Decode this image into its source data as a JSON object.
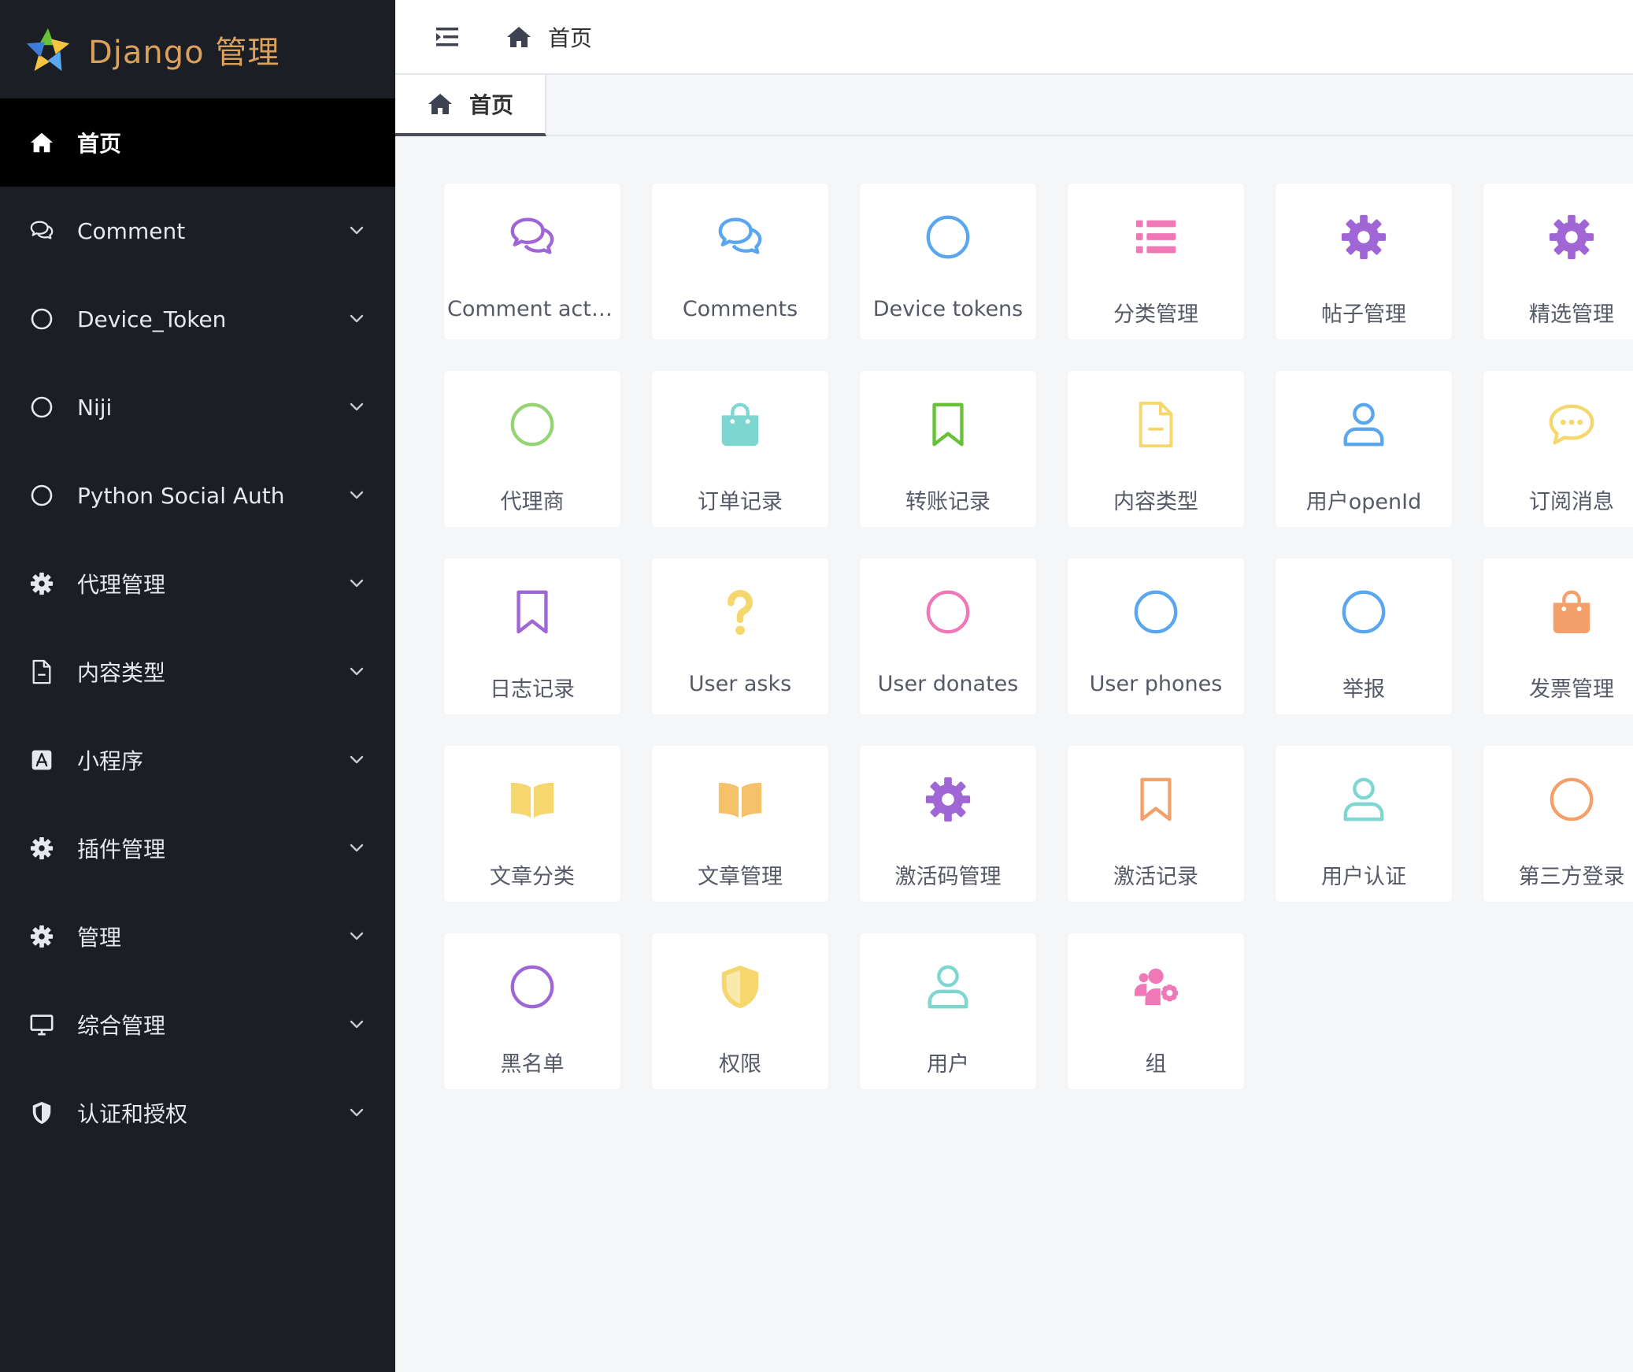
{
  "brand": {
    "title": "Django 管理"
  },
  "header": {
    "breadcrumb": "首页"
  },
  "tabs": [
    {
      "label": "首页"
    }
  ],
  "sidebar": {
    "items": [
      {
        "label": "首页",
        "icon": "home-icon",
        "active": true
      },
      {
        "label": "Comment",
        "icon": "comments-icon"
      },
      {
        "label": "Device_Token",
        "icon": "circle-icon"
      },
      {
        "label": "Niji",
        "icon": "circle-icon"
      },
      {
        "label": "Python Social Auth",
        "icon": "circle-icon"
      },
      {
        "label": "代理管理",
        "icon": "gear-icon"
      },
      {
        "label": "内容类型",
        "icon": "file-icon"
      },
      {
        "label": "小程序",
        "icon": "app-store-icon"
      },
      {
        "label": "插件管理",
        "icon": "gear-icon"
      },
      {
        "label": "管理",
        "icon": "gear-icon"
      },
      {
        "label": "综合管理",
        "icon": "monitor-icon"
      },
      {
        "label": "认证和授权",
        "icon": "shield-icon"
      }
    ]
  },
  "cards": [
    {
      "label": "Comment acti…",
      "icon": "comments-icon",
      "color": "#a066d6"
    },
    {
      "label": "Comments",
      "icon": "comments-icon",
      "color": "#5aa7f0"
    },
    {
      "label": "Device tokens",
      "icon": "circle-icon",
      "color": "#5aa7f0"
    },
    {
      "label": "分类管理",
      "icon": "list-icon",
      "color": "#f178b6"
    },
    {
      "label": "帖子管理",
      "icon": "gear-icon",
      "color": "#a066d6"
    },
    {
      "label": "精选管理",
      "icon": "gear-icon",
      "color": "#a066d6"
    },
    {
      "label": "代理商",
      "icon": "circle-icon",
      "color": "#95d475"
    },
    {
      "label": "订单记录",
      "icon": "shopping-bag-icon",
      "color": "#7ed6d0"
    },
    {
      "label": "转账记录",
      "icon": "bookmark-icon",
      "color": "#67c23a"
    },
    {
      "label": "内容类型",
      "icon": "file-icon",
      "color": "#f5d76e"
    },
    {
      "label": "用户openId",
      "icon": "user-icon",
      "color": "#5aa7f0"
    },
    {
      "label": "订阅消息",
      "icon": "chat-icon",
      "color": "#f5d76e"
    },
    {
      "label": "日志记录",
      "icon": "bookmark-icon",
      "color": "#a066d6"
    },
    {
      "label": "User asks",
      "icon": "question-icon",
      "color": "#f5d76e"
    },
    {
      "label": "User donates",
      "icon": "circle-icon",
      "color": "#f178b6"
    },
    {
      "label": "User phones",
      "icon": "circle-icon",
      "color": "#5aa7f0"
    },
    {
      "label": "举报",
      "icon": "circle-icon",
      "color": "#5aa7f0"
    },
    {
      "label": "发票管理",
      "icon": "shopping-bag-icon",
      "color": "#f4a06b"
    },
    {
      "label": "文章分类",
      "icon": "book-open-icon",
      "color": "#f5d76e"
    },
    {
      "label": "文章管理",
      "icon": "book-open-icon",
      "color": "#f5c26b"
    },
    {
      "label": "激活码管理",
      "icon": "gear-icon",
      "color": "#a066d6"
    },
    {
      "label": "激活记录",
      "icon": "bookmark-icon",
      "color": "#f4a06b"
    },
    {
      "label": "用户认证",
      "icon": "user-icon",
      "color": "#7ed6d0"
    },
    {
      "label": "第三方登录",
      "icon": "circle-icon",
      "color": "#f4a06b"
    },
    {
      "label": "黑名单",
      "icon": "circle-icon",
      "color": "#a066d6"
    },
    {
      "label": "权限",
      "icon": "shield-icon",
      "color": "#f5d76e"
    },
    {
      "label": "用户",
      "icon": "user-icon",
      "color": "#7ed6d0"
    },
    {
      "label": "组",
      "icon": "users-cog-icon",
      "color": "#f178b6"
    }
  ]
}
